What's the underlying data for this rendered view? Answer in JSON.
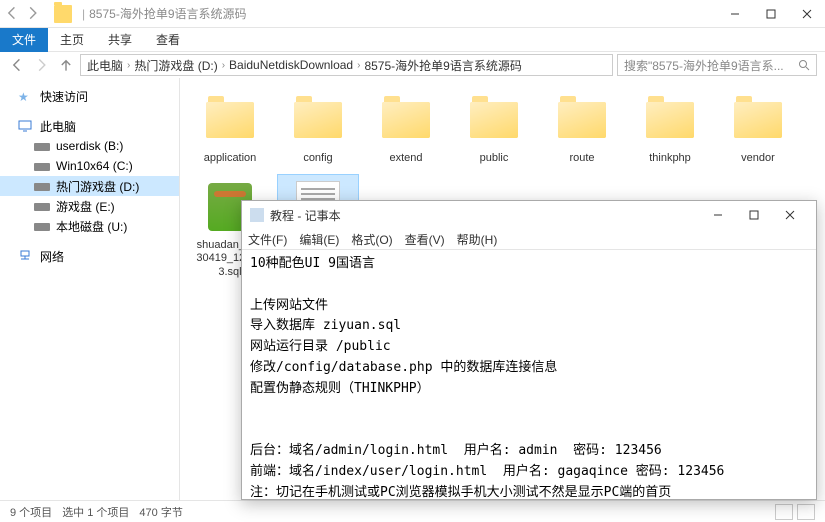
{
  "titlebar": {
    "folder_name": "8575-海外抢单9语言系统源码"
  },
  "ribbon": {
    "file": "文件",
    "home": "主页",
    "share": "共享",
    "view": "查看"
  },
  "breadcrumb": {
    "root": "此电脑",
    "d1": "热门游戏盘 (D:)",
    "d2": "BaiduNetdiskDownload",
    "d3": "8575-海外抢单9语言系统源码"
  },
  "search": {
    "placeholder": "搜索\"8575-海外抢单9语言系..."
  },
  "sidebar": {
    "quick": "快速访问",
    "pc": "此电脑",
    "drives": [
      "userdisk (B:)",
      "Win10x64 (C:)",
      "热门游戏盘 (D:)",
      "游戏盘 (E:)",
      "本地磁盘 (U:)"
    ],
    "network": "网络"
  },
  "files": [
    {
      "name": "application",
      "type": "folder"
    },
    {
      "name": "config",
      "type": "folder"
    },
    {
      "name": "extend",
      "type": "folder"
    },
    {
      "name": "public",
      "type": "folder"
    },
    {
      "name": "route",
      "type": "folder"
    },
    {
      "name": "thinkphp",
      "type": "folder"
    },
    {
      "name": "vendor",
      "type": "folder"
    },
    {
      "name": "shuadan_20230419_124003.sql",
      "type": "sql"
    },
    {
      "name": "教程",
      "type": "text",
      "selected": true
    }
  ],
  "status": {
    "count": "9 个项目",
    "sel": "选中 1 个项目",
    "size": "470 字节"
  },
  "notepad": {
    "title": "教程 - 记事本",
    "menu": {
      "file": "文件(F)",
      "edit": "编辑(E)",
      "format": "格式(O)",
      "view": "查看(V)",
      "help": "帮助(H)"
    },
    "content": "10种配色UI 9国语言\n\n上传网站文件\n导入数据库 ziyuan.sql\n网站运行目录 /public\n修改/config/database.php 中的数据库连接信息\n配置伪静态规则（THINKPHP）\n\n\n后台：域名/admin/login.html  用户名: admin  密码: 123456\n前端：域名/index/user/login.html  用户名: gagaqince 密码: 123456\n注：切记在手机测试或PC浏览器模拟手机大小测试不然是显示PC端的首页"
  }
}
